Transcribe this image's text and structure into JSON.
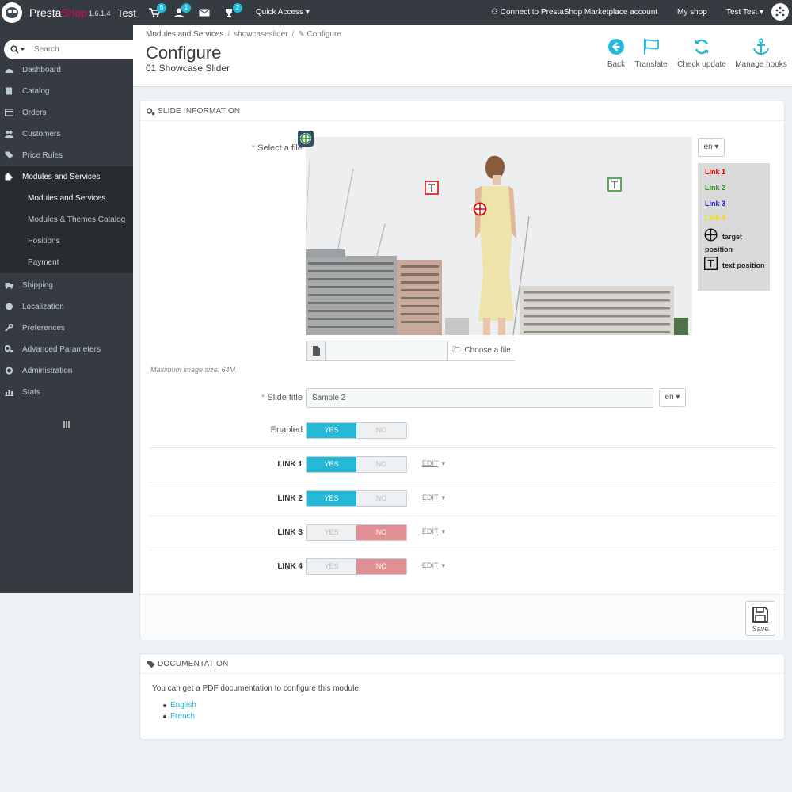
{
  "topbar": {
    "brand_prefix": "Presta",
    "brand_suffix": "Shop",
    "version": "1.6.1.4",
    "shop_name": "Test",
    "cart_badge": "5",
    "customers_badge": "1",
    "trophy_badge": "2",
    "quick_access": "Quick Access",
    "connect": "Connect to PrestaShop Marketplace account",
    "my_shop": "My shop",
    "user": "Test Test"
  },
  "sidebar": {
    "search_placeholder": "Search",
    "items": [
      {
        "label": "Dashboard",
        "icon": "dashboard-icon"
      },
      {
        "label": "Catalog",
        "icon": "book-icon"
      },
      {
        "label": "Orders",
        "icon": "credit-card-icon"
      },
      {
        "label": "Customers",
        "icon": "users-icon"
      },
      {
        "label": "Price Rules",
        "icon": "tag-icon"
      },
      {
        "label": "Modules and Services",
        "icon": "puzzle-icon"
      },
      {
        "label": "Shipping",
        "icon": "truck-icon"
      },
      {
        "label": "Localization",
        "icon": "globe-icon"
      },
      {
        "label": "Preferences",
        "icon": "wrench-icon"
      },
      {
        "label": "Advanced Parameters",
        "icon": "cogs-icon"
      },
      {
        "label": "Administration",
        "icon": "cog-icon"
      },
      {
        "label": "Stats",
        "icon": "bar-chart-icon"
      }
    ],
    "subitems": [
      "Modules and Services",
      "Modules & Themes Catalog",
      "Positions",
      "Payment"
    ]
  },
  "header": {
    "breadcrumb": [
      "Modules and Services",
      "showcaseslider",
      "Configure"
    ],
    "title": "Configure",
    "subtitle": "01 Showcase Slider",
    "toolbar": {
      "back": "Back",
      "translate": "Translate",
      "check_update": "Check update",
      "manage_hooks": "Manage hooks"
    }
  },
  "slide_panel": {
    "heading": "Slide information",
    "select_file_label": "Select a file",
    "lang": "en",
    "legend": {
      "link1": "Link 1",
      "link2": "Link 2",
      "link3": "Link 3",
      "link4": "Link 4",
      "target": "target position",
      "text": "text position"
    },
    "choose_file": "Choose a file",
    "max_size": "Maximum image size: 64M.",
    "slide_title_label": "Slide title",
    "slide_title_value": "Sample 2",
    "enabled_label": "Enabled",
    "yes": "YES",
    "no": "NO",
    "edit": "EDIT",
    "links": [
      {
        "label": "LINK 1",
        "enabled": true
      },
      {
        "label": "LINK 2",
        "enabled": true
      },
      {
        "label": "LINK 3",
        "enabled": false
      },
      {
        "label": "LINK 4",
        "enabled": false
      }
    ],
    "save": "Save"
  },
  "doc_panel": {
    "heading": "Documentation",
    "text": "You can get a PDF documentation to configure this module:",
    "links": [
      "English",
      "French"
    ]
  },
  "colors": {
    "accent": "#25b9d7",
    "danger": "#e08f95",
    "sidebar": "#363a41",
    "link1": "#e00000",
    "link2": "#2e8b2e",
    "link3": "#1c1cc8",
    "link4": "#f0e000"
  }
}
